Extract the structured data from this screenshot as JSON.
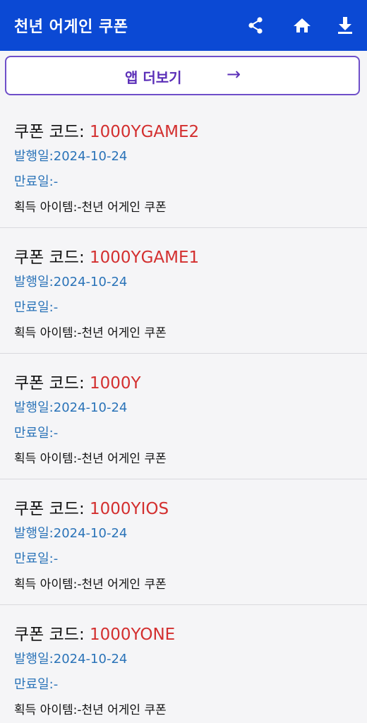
{
  "appbar": {
    "title": "천년 어게인 쿠폰",
    "icons": [
      "share-icon",
      "home-icon",
      "download-icon"
    ]
  },
  "more_apps": {
    "label": "앱 더보기",
    "arrow": "→"
  },
  "colors": {
    "primary": "#0b49d4",
    "accent": "#5b2fb8",
    "code": "#d32f2f",
    "meta": "#2a73b8"
  },
  "coupons": [
    {
      "code_label": "쿠폰 코드: ",
      "code": "1000YGAME2",
      "issued": "발행일:2024-10-24",
      "expiry": "만료일:-",
      "reward": "획득 아이템:-천년 어게인 쿠폰"
    },
    {
      "code_label": "쿠폰 코드: ",
      "code": "1000YGAME1",
      "issued": "발행일:2024-10-24",
      "expiry": "만료일:-",
      "reward": "획득 아이템:-천년 어게인 쿠폰"
    },
    {
      "code_label": "쿠폰 코드: ",
      "code": "1000Y",
      "issued": "발행일:2024-10-24",
      "expiry": "만료일:-",
      "reward": "획득 아이템:-천년 어게인 쿠폰"
    },
    {
      "code_label": "쿠폰 코드: ",
      "code": "1000YIOS",
      "issued": "발행일:2024-10-24",
      "expiry": "만료일:-",
      "reward": "획득 아이템:-천년 어게인 쿠폰"
    },
    {
      "code_label": "쿠폰 코드: ",
      "code": "1000YONE",
      "issued": "발행일:2024-10-24",
      "expiry": "만료일:-",
      "reward": "획득 아이템:-천년 어게인 쿠폰"
    }
  ]
}
